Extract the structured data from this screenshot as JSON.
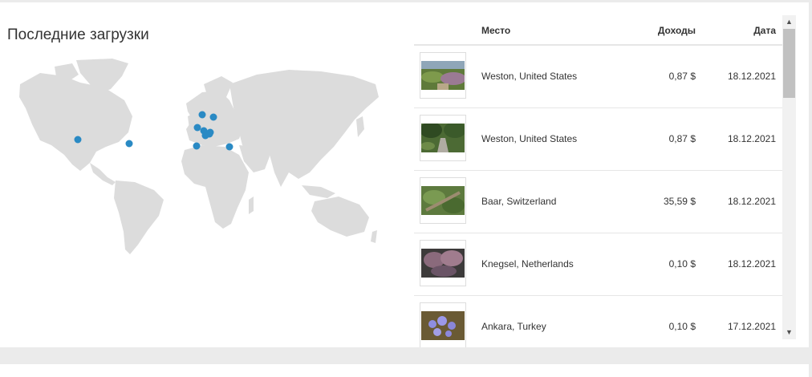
{
  "title": "Последние загрузки",
  "table": {
    "headers": {
      "place": "Место",
      "income": "Доходы",
      "date": "Дата"
    },
    "rows": [
      {
        "place": "Weston, United States",
        "income": "0,87 $",
        "date": "18.12.2021"
      },
      {
        "place": "Weston, United States",
        "income": "0,87 $",
        "date": "18.12.2021"
      },
      {
        "place": "Baar, Switzerland",
        "income": "35,59 $",
        "date": "18.12.2021"
      },
      {
        "place": "Knegsel, Netherlands",
        "income": "0,10 $",
        "date": "18.12.2021"
      },
      {
        "place": "Ankara, Turkey",
        "income": "0,10 $",
        "date": "17.12.2021"
      }
    ]
  },
  "scrollbar": {
    "up_icon": "▲",
    "down_icon": "▼"
  },
  "colors": {
    "pin": "#2a8ac4",
    "land": "#dcdcdc"
  }
}
